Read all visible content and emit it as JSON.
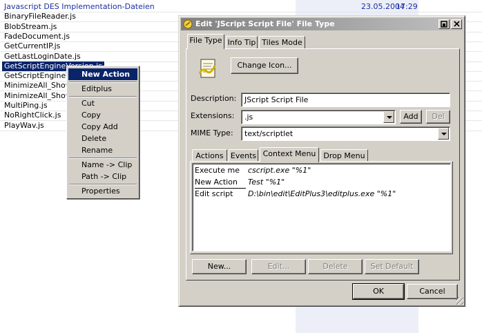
{
  "file_list": {
    "rows": [
      {
        "name": "Javascript DES Implementation-Dateien",
        "date": "23.05.2004",
        "time": "17:29",
        "link": true
      },
      {
        "name": "BinaryFileReader.js"
      },
      {
        "name": "BlobStream.js"
      },
      {
        "name": "FadeDocument.js"
      },
      {
        "name": "GetCurrentIP.js"
      },
      {
        "name": "GetLastLoginDate.js"
      },
      {
        "name": "GetScriptEngineVersion.js",
        "selected": true
      },
      {
        "name": "GetScriptEngineVer"
      },
      {
        "name": "MinimizeAll_ShowD"
      },
      {
        "name": "MinimizeAll_ShowD"
      },
      {
        "name": "MultiPing.js"
      },
      {
        "name": "NoRightClick.js"
      },
      {
        "name": "PlayWav.js"
      }
    ]
  },
  "context_menu": {
    "items": [
      "New Action",
      "Editplus",
      "Cut",
      "Copy",
      "Copy Add",
      "Delete",
      "Rename",
      "Name -> Clip",
      "Path -> Clip",
      "Properties"
    ]
  },
  "dialog": {
    "title": "Edit 'JScript Script File' File Type",
    "tabs": [
      "File Type",
      "Info Tip",
      "Tiles Mode"
    ],
    "change_icon": "Change Icon...",
    "description_label": "Description:",
    "description_value": "JScript Script File",
    "extensions_label": "Extensions:",
    "extensions_value": ".js",
    "add_label": "Add",
    "del_label": "Del",
    "mime_label": "MIME Type:",
    "mime_value": "text/scriptlet",
    "subtabs": [
      "Actions",
      "Events",
      "Context Menu",
      "Drop Menu"
    ],
    "actions": [
      {
        "name": "Execute me",
        "cmd": "cscript.exe \"%1\""
      },
      {
        "name": "New Action",
        "cmd": "Test \"%1\""
      },
      {
        "name": "Edit script",
        "cmd": "D:\\bin\\edit\\EditPlus3\\editplus.exe \"%1\""
      }
    ],
    "buttons": {
      "new": "New...",
      "edit": "Edit...",
      "delete": "Delete",
      "set_default": "Set Default"
    },
    "ok": "OK",
    "cancel": "Cancel"
  },
  "colors": {
    "selection": "#0a246a",
    "link": "#1a2fa0",
    "face": "#d4d0c8"
  }
}
